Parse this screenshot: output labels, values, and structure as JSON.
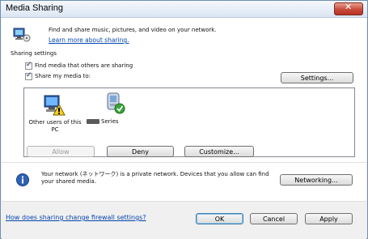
{
  "window": {
    "title": "Media Sharing"
  },
  "header": {
    "description": "Find and share music, pictures, and video on your network.",
    "learn_more": "Learn more about sharing."
  },
  "settings": {
    "section_label": "Sharing settings",
    "find_media_label": "Find media that others are sharing",
    "find_media_checked": true,
    "share_media_label": "Share my media to:",
    "share_media_checked": true,
    "settings_button": "Settings..."
  },
  "devices": [
    {
      "label": "Other users of this PC",
      "status": "warning"
    },
    {
      "label": "Series",
      "status": "allowed"
    }
  ],
  "device_actions": {
    "allow": "Allow",
    "deny": "Deny",
    "customize": "Customize..."
  },
  "network_info": {
    "text": "Your network (ネットワーク) is a private network. Devices that you allow can find your shared media.",
    "networking_button": "Networking..."
  },
  "footer": {
    "firewall_link": "How does sharing change firewall settings?",
    "ok": "OK",
    "cancel": "Cancel",
    "apply": "Apply"
  }
}
